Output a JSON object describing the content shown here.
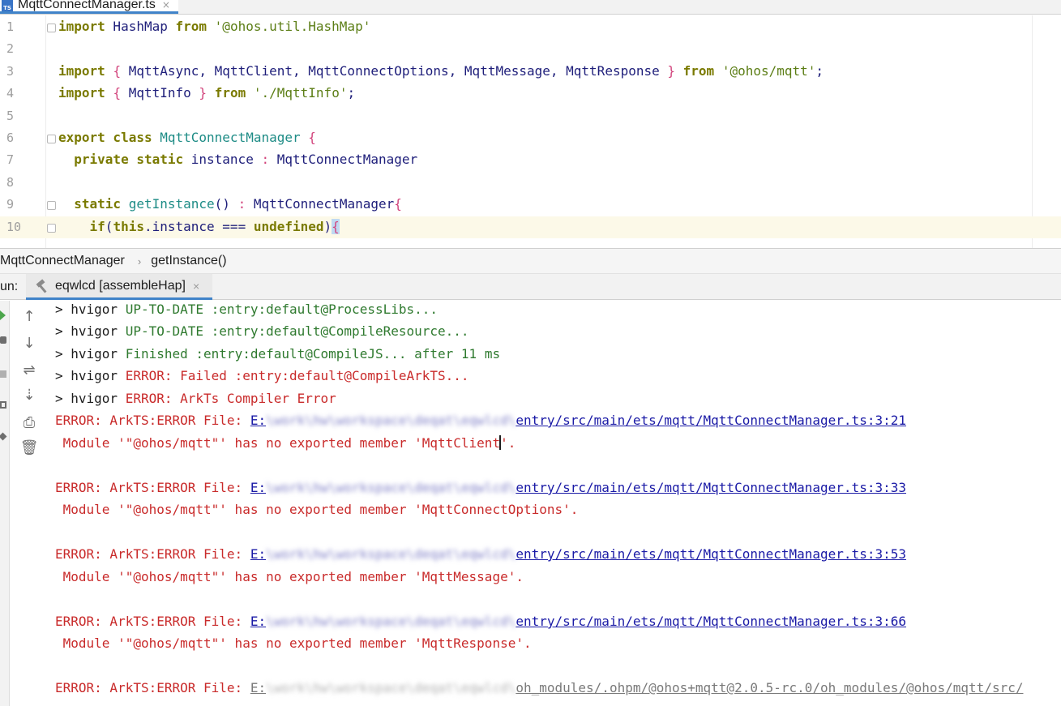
{
  "editor_tab": {
    "icon_text": "TS",
    "title": "MqttConnectManager.ts",
    "close": "×"
  },
  "code_lines": [
    {
      "no": "1",
      "tokens": [
        [
          "kw",
          "import"
        ],
        [
          "plain",
          " HashMap "
        ],
        [
          "kw",
          "from"
        ],
        [
          "plain",
          " "
        ],
        [
          "str",
          "'@ohos.util.HashMap'"
        ]
      ]
    },
    {
      "no": "2",
      "tokens": []
    },
    {
      "no": "3",
      "tokens": [
        [
          "kw",
          "import"
        ],
        [
          "plain",
          " "
        ],
        [
          "pun",
          "{"
        ],
        [
          "plain",
          " MqttAsync, MqttClient, MqttConnectOptions, MqttMessage, MqttResponse "
        ],
        [
          "pun",
          "}"
        ],
        [
          "plain",
          " "
        ],
        [
          "kw",
          "from"
        ],
        [
          "plain",
          " "
        ],
        [
          "str",
          "'@ohos/mqtt'"
        ],
        [
          "plain",
          ";"
        ]
      ]
    },
    {
      "no": "4",
      "tokens": [
        [
          "kw",
          "import"
        ],
        [
          "plain",
          " "
        ],
        [
          "pun",
          "{"
        ],
        [
          "plain",
          " MqttInfo "
        ],
        [
          "pun",
          "}"
        ],
        [
          "plain",
          " "
        ],
        [
          "kw",
          "from"
        ],
        [
          "plain",
          " "
        ],
        [
          "str",
          "'./MqttInfo'"
        ],
        [
          "plain",
          ";"
        ]
      ]
    },
    {
      "no": "5",
      "tokens": []
    },
    {
      "no": "6",
      "tokens": [
        [
          "kw",
          "export class"
        ],
        [
          "plain",
          " "
        ],
        [
          "cls",
          "MqttConnectManager"
        ],
        [
          "plain",
          " "
        ],
        [
          "pun",
          "{"
        ]
      ]
    },
    {
      "no": "7",
      "tokens": [
        [
          "plain",
          "  "
        ],
        [
          "kw",
          "private static"
        ],
        [
          "plain",
          " instance "
        ],
        [
          "pun",
          ":"
        ],
        [
          "plain",
          " MqttConnectManager"
        ]
      ]
    },
    {
      "no": "8",
      "tokens": []
    },
    {
      "no": "9",
      "tokens": [
        [
          "plain",
          "  "
        ],
        [
          "kw",
          "static"
        ],
        [
          "plain",
          " "
        ],
        [
          "fn",
          "getInstance"
        ],
        [
          "plain",
          "() "
        ],
        [
          "pun",
          ":"
        ],
        [
          "plain",
          " MqttConnectManager"
        ],
        [
          "pun",
          "{"
        ]
      ]
    },
    {
      "no": "10",
      "tokens": [
        [
          "plain",
          "    "
        ],
        [
          "kw",
          "if"
        ],
        [
          "plain",
          "("
        ],
        [
          "kw",
          "this"
        ],
        [
          "plain",
          ".instance === "
        ],
        [
          "kw",
          "undefined"
        ],
        [
          "plain",
          ")"
        ],
        [
          "pun",
          "{"
        ]
      ]
    }
  ],
  "breadcrumb": {
    "items": [
      "MqttConnectManager",
      "getInstance()"
    ],
    "separator": "›"
  },
  "run_panel": {
    "label": "un:",
    "tab_title": "eqwlcd [assembleHap]",
    "tab_close": "×",
    "toolbar": {
      "up": "↑",
      "down": "↓",
      "wrap": "⇌",
      "scroll_end": "⇣",
      "print": "⎙",
      "clear": "🗑"
    }
  },
  "console": {
    "lines": [
      {
        "prefix": "> hvigor ",
        "status": "UP-TO-DATE :entry:default@ProcessLibs...",
        "status_color": "green"
      },
      {
        "prefix": "> hvigor ",
        "status": "UP-TO-DATE :entry:default@CompileResource...",
        "status_color": "green"
      },
      {
        "prefix": "> hvigor ",
        "status": "Finished :entry:default@CompileJS... after 11 ms",
        "status_color": "green"
      },
      {
        "prefix": "> hvigor ",
        "status": "ERROR: Failed :entry:default@CompileArkTS...",
        "status_color": "red"
      },
      {
        "prefix": "> hvigor ",
        "status": "ERROR: ArkTs Compiler Error",
        "status_color": "red"
      }
    ],
    "errors": [
      {
        "label": "ERROR: ArkTS:ERROR File: ",
        "link_start": "E:",
        "link_blur": "\\work\\hw\\workspace\\deqat\\eqwlcd\\",
        "link_end": "entry/src/main/ets/mqtt/MqttConnectManager.ts:3:21",
        "message": " Module '\"@ohos/mqtt\"' has no exported member 'MqttClient'."
      },
      {
        "label": "ERROR: ArkTS:ERROR File: ",
        "link_start": "E:",
        "link_blur": "\\work\\hw\\workspace\\deqat\\eqwlcd\\",
        "link_end": "entry/src/main/ets/mqtt/MqttConnectManager.ts:3:33",
        "message": " Module '\"@ohos/mqtt\"' has no exported member 'MqttConnectOptions'."
      },
      {
        "label": "ERROR: ArkTS:ERROR File: ",
        "link_start": "E:",
        "link_blur": "\\work\\hw\\workspace\\deqat\\eqwlcd\\",
        "link_end": "entry/src/main/ets/mqtt/MqttConnectManager.ts:3:53",
        "message": " Module '\"@ohos/mqtt\"' has no exported member 'MqttMessage'."
      },
      {
        "label": "ERROR: ArkTS:ERROR File: ",
        "link_start": "E:",
        "link_blur": "\\work\\hw\\workspace\\deqat\\eqwlcd\\",
        "link_end": "entry/src/main/ets/mqtt/MqttConnectManager.ts:3:66",
        "message": " Module '\"@ohos/mqtt\"' has no exported member 'MqttResponse'."
      },
      {
        "label": "ERROR: ArkTS:ERROR File: ",
        "link_start": "E:",
        "link_blur": "\\work\\hw\\workspace\\deqat\\eqwlcd\\",
        "link_end": "oh_modules/.ohpm/@ohos+mqtt@2.0.5-rc.0/oh_modules/@ohos/mqtt/src/",
        "message": ""
      }
    ]
  }
}
